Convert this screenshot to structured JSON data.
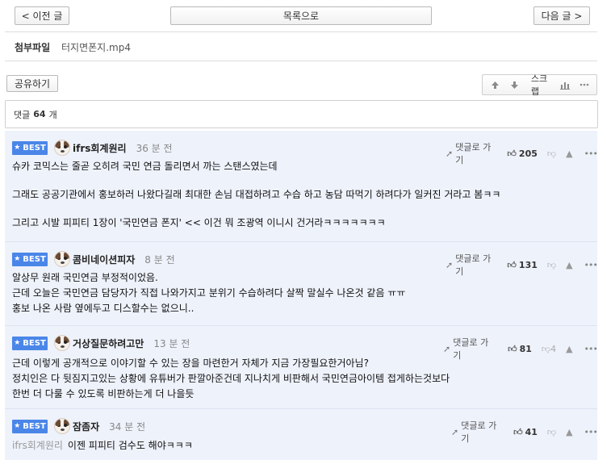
{
  "nav": {
    "prev_label": "< 이전 글",
    "list_label": "목록으로",
    "next_label": "다음 글 >"
  },
  "attachment": {
    "label": "첨부파일",
    "filename": "터지면폰지.mp4"
  },
  "share_label": "공유하기",
  "toolbar": {
    "up_icon": "arrow-up-icon",
    "down_icon": "arrow-down-icon",
    "scrap_label": "스크랩",
    "stats_icon": "bar-chart-icon",
    "more_icon": "more-icon"
  },
  "comments_header": {
    "prefix": "댓글",
    "count": "64",
    "suffix": "개"
  },
  "comments": [
    {
      "badge": "BEST",
      "author": "ifrs회계원리",
      "time": "36 분 전",
      "reply_label": "댓글로 가기",
      "likes": "205",
      "dislikes": "",
      "lines": [
        "슈카 코믹스는 줄곧 오히려 국민 연금 돌리면서 까는 스탠스였는데",
        "",
        "그래도 공공기관에서 홍보하러 나왔다길래 최대한 손님 대접하려고 수습 하고 농담 따먹기 하려다가 일커진 거라고 봄ㅋㅋ",
        "",
        "그리고 시발 피피티 1장이 '국민연금 폰지' << 이건 뭐 조광역 이니시 건거라ㅋㅋㅋㅋㅋㅋㅋ"
      ]
    },
    {
      "badge": "BEST",
      "author": "콤비네이션피자",
      "time": "8 분 전",
      "reply_label": "댓글로 가기",
      "likes": "131",
      "dislikes": "",
      "lines": [
        "알상무 원래 국민연금 부정적이었음.",
        "근데 오늘은 국민연금 담당자가 직접 나와가지고 분위기 수습하려다 살짝 말실수 나온것 같음 ㅠㅠ",
        "홍보 나온 사람 옆에두고 디스할수는 없으니.."
      ]
    },
    {
      "badge": "BEST",
      "author": "거상질문하려고만",
      "time": "13 분 전",
      "reply_label": "댓글로 가기",
      "likes": "81",
      "dislikes": "4",
      "lines": [
        "근데 이렇게 공개적으로 이야기할 수 있는 장을 마련한거 자체가 지금 가장필요한거아님?",
        "정치인은 다 뒷짐지고있는 상황에 유튜버가 판깔아준건데 지나치게 비판해서 국민연금아이템 접게하는것보다",
        "한번 더 다룰 수 있도록 비판하는게 더 나을듯"
      ]
    },
    {
      "badge": "BEST",
      "author": "잠좀자",
      "time": "34 분 전",
      "reply_label": "댓글로 가기",
      "likes": "41",
      "dislikes": "",
      "reply_to": "ifrs회계원리",
      "lines": [
        "이젠 피피티 검수도 해야ㅋㅋㅋ"
      ]
    }
  ]
}
